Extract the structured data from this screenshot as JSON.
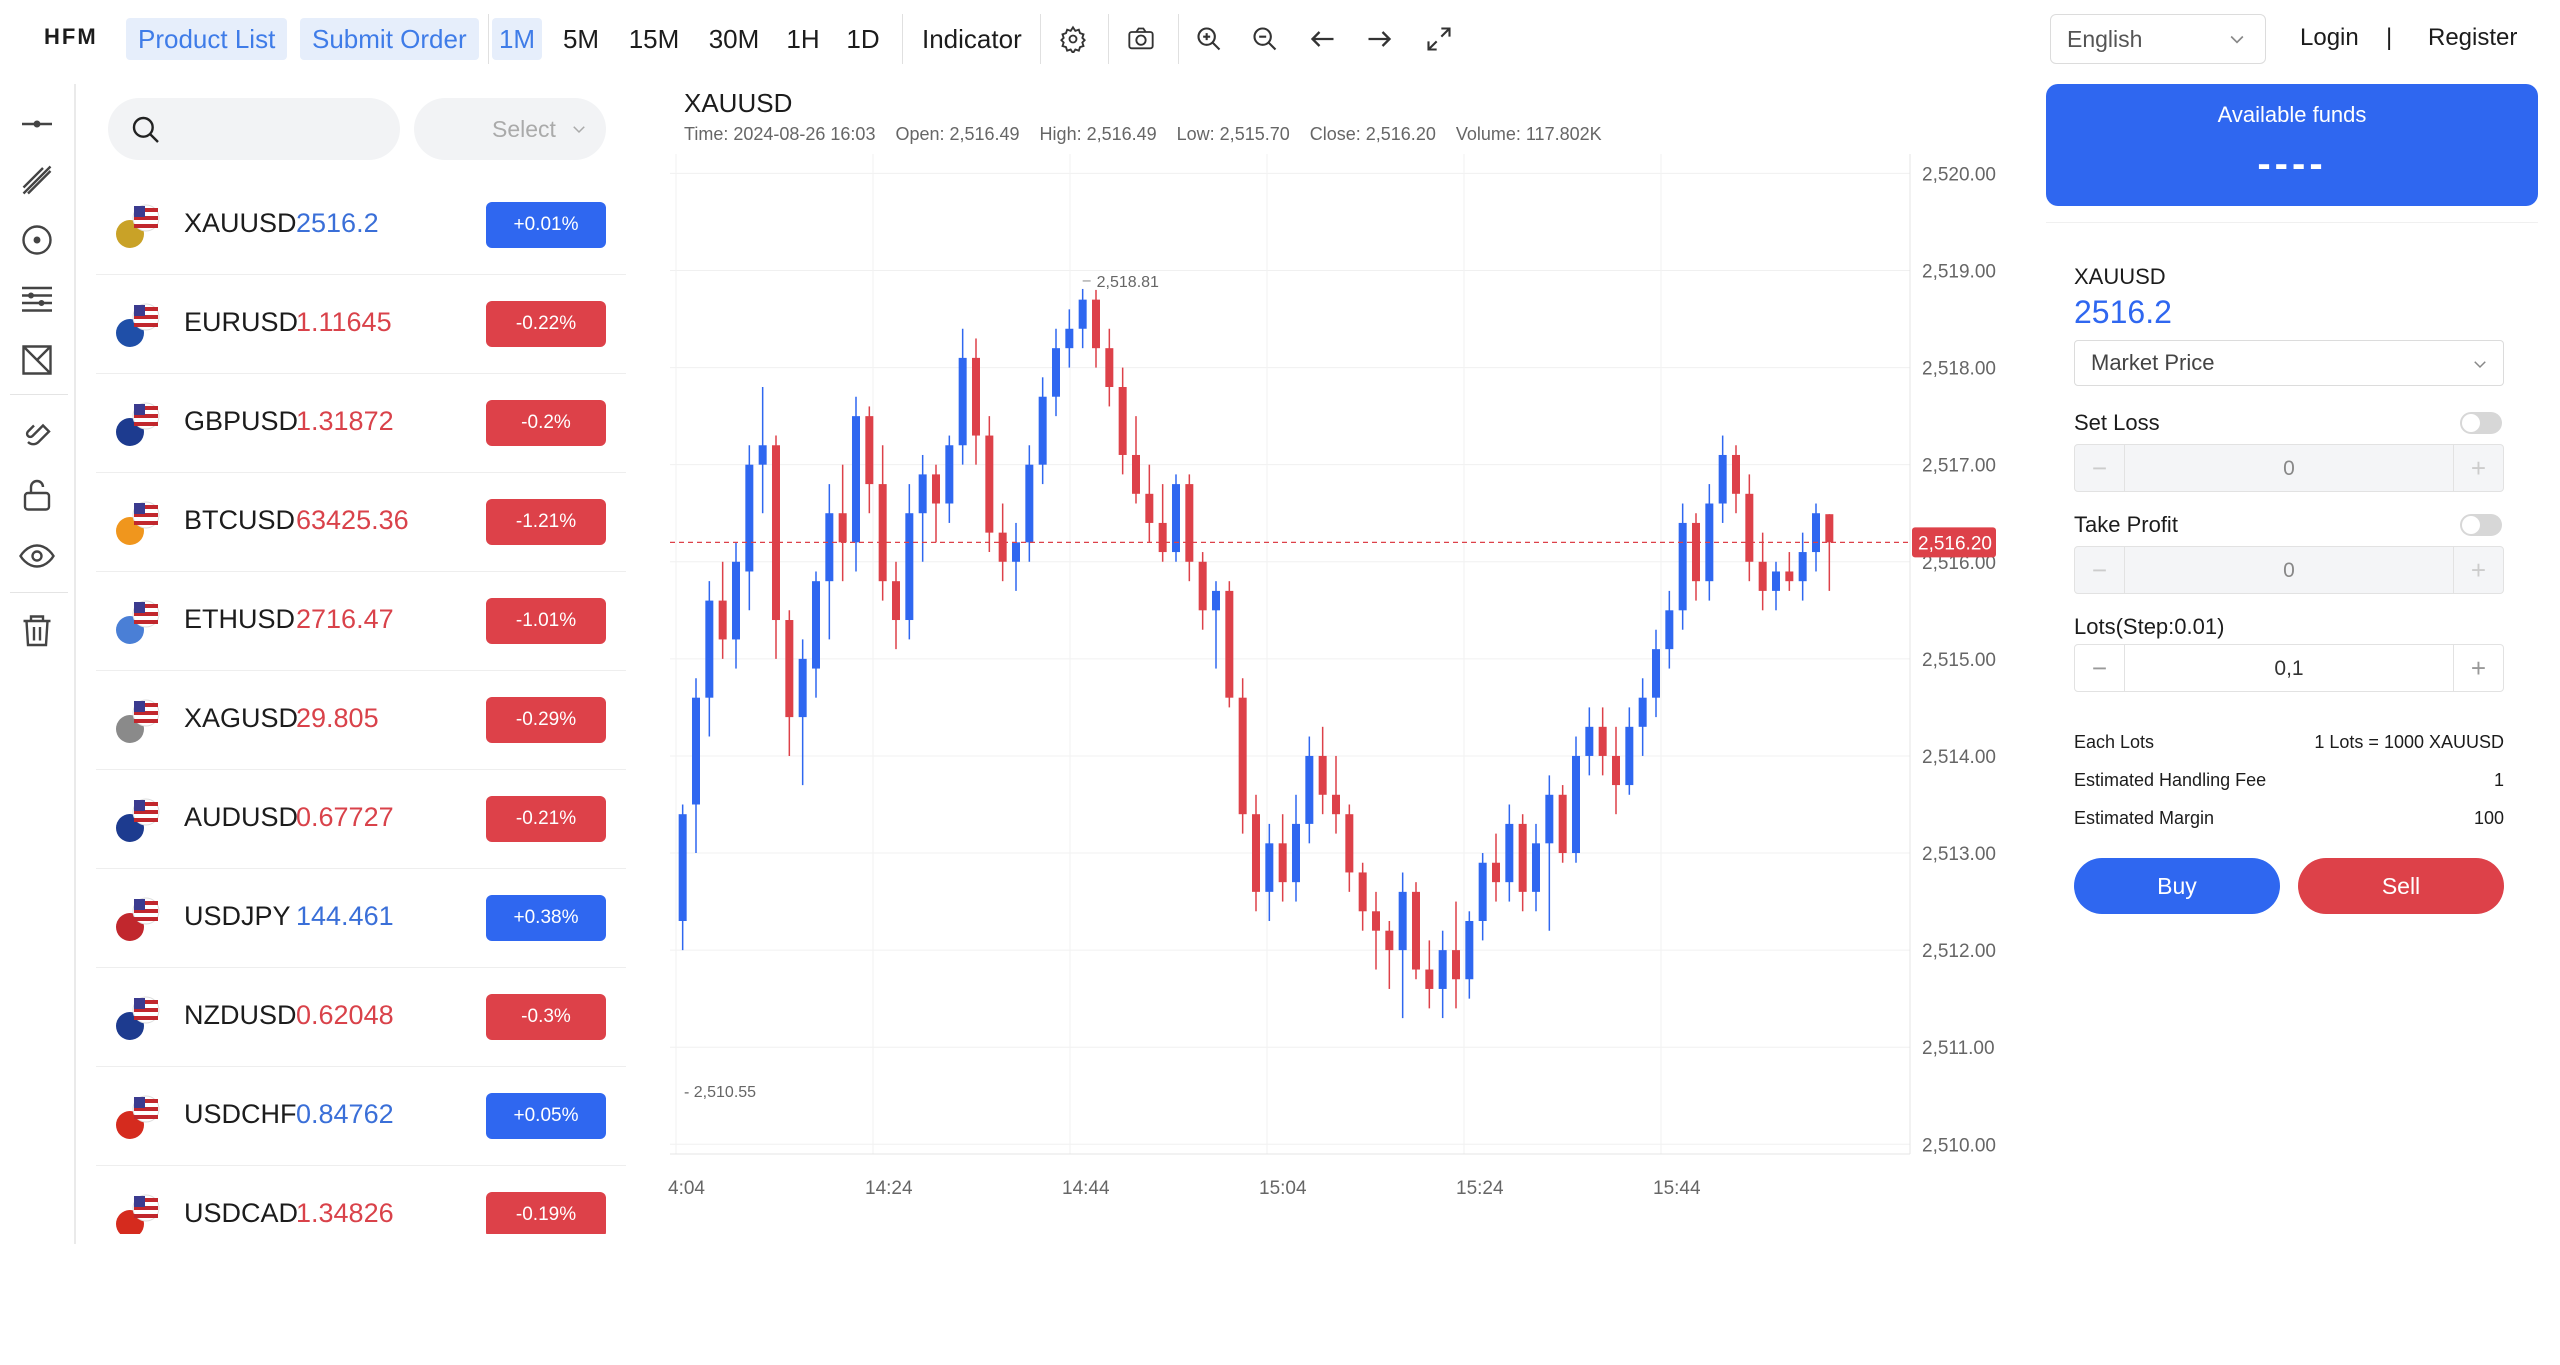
{
  "header": {
    "logo": "HFM",
    "nav": [
      "Product List",
      "Submit Order"
    ],
    "timeframes": [
      "1M",
      "5M",
      "15M",
      "30M",
      "1H",
      "1D"
    ],
    "active_timeframe": "1M",
    "indicator": "Indicator",
    "language": "English",
    "login": "Login",
    "divider": "|",
    "register": "Register"
  },
  "toolbar_icons": [
    "line-tool-icon",
    "pen-tool-icon",
    "circle-tool-icon",
    "fib-lines-icon",
    "shape-tool-icon",
    "magnet-icon",
    "lock-icon",
    "eye-icon",
    "trash-icon"
  ],
  "watchlist": {
    "select_placeholder": "Select",
    "items": [
      {
        "symbol": "XAUUSD",
        "price": "2516.2",
        "change": "+0.01%",
        "dir": "up"
      },
      {
        "symbol": "EURUSD",
        "price": "1.11645",
        "change": "-0.22%",
        "dir": "dn"
      },
      {
        "symbol": "GBPUSD",
        "price": "1.31872",
        "change": "-0.2%",
        "dir": "dn"
      },
      {
        "symbol": "BTCUSD",
        "price": "63425.36",
        "change": "-1.21%",
        "dir": "dn"
      },
      {
        "symbol": "ETHUSD",
        "price": "2716.47",
        "change": "-1.01%",
        "dir": "dn"
      },
      {
        "symbol": "XAGUSD",
        "price": "29.805",
        "change": "-0.29%",
        "dir": "dn"
      },
      {
        "symbol": "AUDUSD",
        "price": "0.67727",
        "change": "-0.21%",
        "dir": "dn"
      },
      {
        "symbol": "USDJPY",
        "price": "144.461",
        "change": "+0.38%",
        "dir": "up"
      },
      {
        "symbol": "NZDUSD",
        "price": "0.62048",
        "change": "-0.3%",
        "dir": "dn"
      },
      {
        "symbol": "USDCHF",
        "price": "0.84762",
        "change": "+0.05%",
        "dir": "up"
      },
      {
        "symbol": "USDCAD",
        "price": "1.34826",
        "change": "-0.19%",
        "dir": "dn"
      }
    ]
  },
  "chart": {
    "title": "XAUUSD",
    "ohlc_text": "Time: 2024-08-26 16:03    Open: 2,516.49    High: 2,516.49    Low: 2,515.70    Close: 2,516.20    Volume: 117.802K"
  },
  "chart_data": {
    "type": "candlestick",
    "symbol": "XAUUSD",
    "y_ticks": [
      "2,520.00",
      "2,519.00",
      "2,518.00",
      "2,517.00",
      "2,516.00",
      "2,515.00",
      "2,514.00",
      "2,513.00",
      "2,512.00",
      "2,511.00",
      "2,510.00"
    ],
    "ylim": [
      2509.9,
      2520.2
    ],
    "x_ticks": [
      "4:04",
      "14:24",
      "14:44",
      "15:04",
      "15:24",
      "15:44"
    ],
    "current_price_label": "2,516.20",
    "current_price": 2516.2,
    "high_marker_label": "2,518.81",
    "high_marker": 2518.81,
    "low_marker_label": "2,510.55",
    "low_marker": 2510.55,
    "up_color": "#2f67f0",
    "down_color": "#dd4149",
    "candles": [
      [
        2512.3,
        2513.5,
        2512.0,
        2513.4
      ],
      [
        2513.5,
        2514.8,
        2513.0,
        2514.6
      ],
      [
        2514.6,
        2515.8,
        2514.2,
        2515.6
      ],
      [
        2515.6,
        2516.0,
        2515.0,
        2515.2
      ],
      [
        2515.2,
        2516.2,
        2514.9,
        2516.0
      ],
      [
        2515.9,
        2517.2,
        2515.5,
        2517.0
      ],
      [
        2517.0,
        2517.8,
        2516.5,
        2517.2
      ],
      [
        2517.2,
        2517.3,
        2515.0,
        2515.4
      ],
      [
        2515.4,
        2515.5,
        2514.0,
        2514.4
      ],
      [
        2514.4,
        2515.2,
        2513.7,
        2515.0
      ],
      [
        2514.9,
        2515.9,
        2514.6,
        2515.8
      ],
      [
        2515.8,
        2516.8,
        2515.2,
        2516.5
      ],
      [
        2516.5,
        2517.0,
        2515.8,
        2516.2
      ],
      [
        2516.2,
        2517.7,
        2515.9,
        2517.5
      ],
      [
        2517.5,
        2517.6,
        2516.5,
        2516.8
      ],
      [
        2516.8,
        2517.2,
        2515.6,
        2515.8
      ],
      [
        2515.8,
        2516.0,
        2515.1,
        2515.4
      ],
      [
        2515.4,
        2516.8,
        2515.2,
        2516.5
      ],
      [
        2516.5,
        2517.1,
        2516.0,
        2516.9
      ],
      [
        2516.9,
        2517.0,
        2516.2,
        2516.6
      ],
      [
        2516.6,
        2517.3,
        2516.4,
        2517.2
      ],
      [
        2517.2,
        2518.4,
        2517.0,
        2518.1
      ],
      [
        2518.1,
        2518.3,
        2517.0,
        2517.3
      ],
      [
        2517.3,
        2517.5,
        2516.1,
        2516.3
      ],
      [
        2516.3,
        2516.6,
        2515.8,
        2516.0
      ],
      [
        2516.0,
        2516.4,
        2515.7,
        2516.2
      ],
      [
        2516.2,
        2517.2,
        2516.0,
        2517.0
      ],
      [
        2517.0,
        2517.9,
        2516.8,
        2517.7
      ],
      [
        2517.7,
        2518.4,
        2517.5,
        2518.2
      ],
      [
        2518.2,
        2518.6,
        2518.0,
        2518.4
      ],
      [
        2518.4,
        2518.81,
        2518.2,
        2518.7
      ],
      [
        2518.7,
        2518.8,
        2518.0,
        2518.2
      ],
      [
        2518.2,
        2518.4,
        2517.6,
        2517.8
      ],
      [
        2517.8,
        2518.0,
        2516.9,
        2517.1
      ],
      [
        2517.1,
        2517.5,
        2516.6,
        2516.7
      ],
      [
        2516.7,
        2517.0,
        2516.2,
        2516.4
      ],
      [
        2516.4,
        2516.8,
        2516.0,
        2516.1
      ],
      [
        2516.1,
        2516.9,
        2516.0,
        2516.8
      ],
      [
        2516.8,
        2516.9,
        2515.8,
        2516.0
      ],
      [
        2516.0,
        2516.1,
        2515.3,
        2515.5
      ],
      [
        2515.5,
        2515.8,
        2514.9,
        2515.7
      ],
      [
        2515.7,
        2515.8,
        2514.5,
        2514.6
      ],
      [
        2514.6,
        2514.8,
        2513.2,
        2513.4
      ],
      [
        2513.4,
        2513.6,
        2512.4,
        2512.6
      ],
      [
        2512.6,
        2513.3,
        2512.3,
        2513.1
      ],
      [
        2513.1,
        2513.4,
        2512.5,
        2512.7
      ],
      [
        2512.7,
        2513.6,
        2512.5,
        2513.3
      ],
      [
        2513.3,
        2514.2,
        2513.1,
        2514.0
      ],
      [
        2514.0,
        2514.3,
        2513.4,
        2513.6
      ],
      [
        2513.6,
        2514.0,
        2513.2,
        2513.4
      ],
      [
        2513.4,
        2513.5,
        2512.6,
        2512.8
      ],
      [
        2512.8,
        2512.9,
        2512.2,
        2512.4
      ],
      [
        2512.4,
        2512.6,
        2511.8,
        2512.2
      ],
      [
        2512.2,
        2512.3,
        2511.6,
        2512.0
      ],
      [
        2512.0,
        2512.8,
        2511.3,
        2512.6
      ],
      [
        2512.6,
        2512.7,
        2511.7,
        2511.8
      ],
      [
        2511.8,
        2512.1,
        2511.4,
        2511.6
      ],
      [
        2511.6,
        2512.2,
        2511.3,
        2512.0
      ],
      [
        2512.0,
        2512.5,
        2511.4,
        2511.7
      ],
      [
        2511.7,
        2512.4,
        2511.5,
        2512.3
      ],
      [
        2512.3,
        2513.0,
        2512.1,
        2512.9
      ],
      [
        2512.9,
        2513.2,
        2512.5,
        2512.7
      ],
      [
        2512.7,
        2513.5,
        2512.5,
        2513.3
      ],
      [
        2513.3,
        2513.4,
        2512.4,
        2512.6
      ],
      [
        2512.6,
        2513.3,
        2512.4,
        2513.1
      ],
      [
        2513.1,
        2513.8,
        2512.2,
        2513.6
      ],
      [
        2513.6,
        2513.7,
        2512.9,
        2513.0
      ],
      [
        2513.0,
        2514.2,
        2512.9,
        2514.0
      ],
      [
        2514.0,
        2514.5,
        2513.8,
        2514.3
      ],
      [
        2514.3,
        2514.5,
        2513.8,
        2514.0
      ],
      [
        2514.0,
        2514.3,
        2513.4,
        2513.7
      ],
      [
        2513.7,
        2514.5,
        2513.6,
        2514.3
      ],
      [
        2514.3,
        2514.8,
        2514.0,
        2514.6
      ],
      [
        2514.6,
        2515.3,
        2514.4,
        2515.1
      ],
      [
        2515.1,
        2515.7,
        2514.9,
        2515.5
      ],
      [
        2515.5,
        2516.6,
        2515.3,
        2516.4
      ],
      [
        2516.4,
        2516.5,
        2515.6,
        2515.8
      ],
      [
        2515.8,
        2516.8,
        2515.6,
        2516.6
      ],
      [
        2516.6,
        2517.3,
        2516.4,
        2517.1
      ],
      [
        2517.1,
        2517.2,
        2516.5,
        2516.7
      ],
      [
        2516.7,
        2516.9,
        2515.8,
        2516.0
      ],
      [
        2516.0,
        2516.3,
        2515.5,
        2515.7
      ],
      [
        2515.7,
        2516.0,
        2515.5,
        2515.9
      ],
      [
        2515.9,
        2516.1,
        2515.7,
        2515.8
      ],
      [
        2515.8,
        2516.3,
        2515.6,
        2516.1
      ],
      [
        2516.1,
        2516.6,
        2515.9,
        2516.5
      ],
      [
        2516.49,
        2516.49,
        2515.7,
        2516.2
      ]
    ]
  },
  "order": {
    "funds_label": "Available funds",
    "funds_value": "----",
    "symbol": "XAUUSD",
    "price": "2516.2",
    "price_type": "Market Price",
    "set_loss": "Set Loss",
    "set_loss_value": "0",
    "take_profit": "Take Profit",
    "take_profit_value": "0",
    "lots_label": "Lots(Step:0.01)",
    "lots_value": "0,1",
    "minus": "−",
    "plus": "+",
    "each_lots_label": "Each Lots",
    "each_lots_value": "1 Lots = 1000 XAUUSD",
    "fee_label": "Estimated Handling Fee",
    "fee_value": "1",
    "margin_label": "Estimated Margin",
    "margin_value": "100",
    "buy": "Buy",
    "sell": "Sell"
  }
}
